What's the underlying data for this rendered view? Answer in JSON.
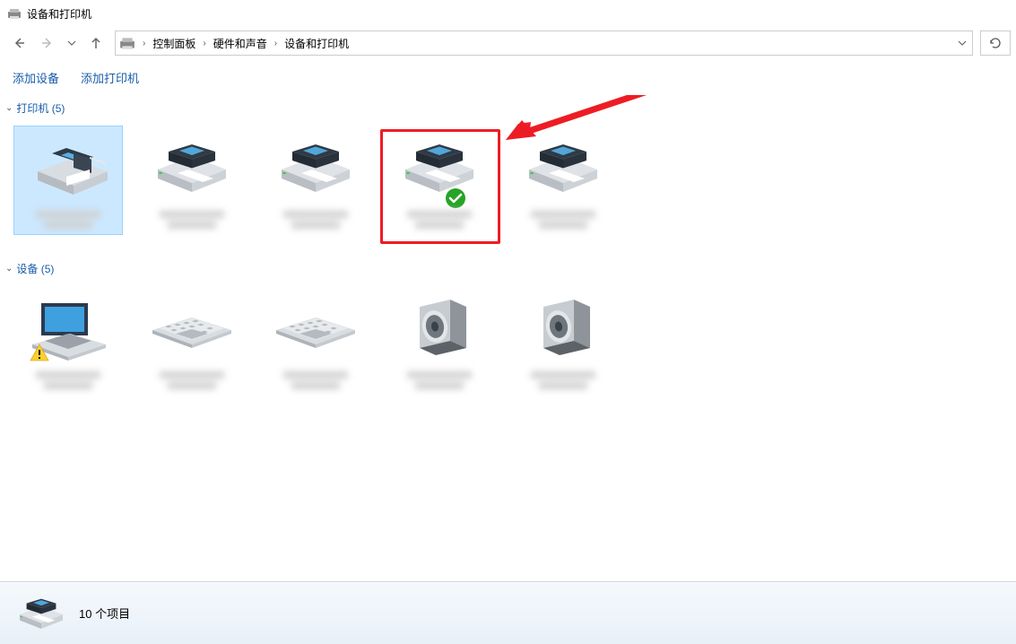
{
  "window": {
    "title": "设备和打印机"
  },
  "breadcrumb": {
    "items": [
      "控制面板",
      "硬件和声音",
      "设备和打印机"
    ]
  },
  "toolbar": {
    "add_device": "添加设备",
    "add_printer": "添加打印机"
  },
  "groups": {
    "printers": {
      "label": "打印机 (5)",
      "items": [
        {
          "type": "fax",
          "selected": true
        },
        {
          "type": "printer"
        },
        {
          "type": "printer"
        },
        {
          "type": "printer",
          "default": true,
          "highlighted": true
        },
        {
          "type": "printer"
        }
      ]
    },
    "devices": {
      "label": "设备 (5)",
      "items": [
        {
          "type": "laptop",
          "warning": true
        },
        {
          "type": "keyboard"
        },
        {
          "type": "keyboard"
        },
        {
          "type": "speaker"
        },
        {
          "type": "speaker"
        }
      ]
    }
  },
  "status": {
    "text": "10 个项目"
  }
}
